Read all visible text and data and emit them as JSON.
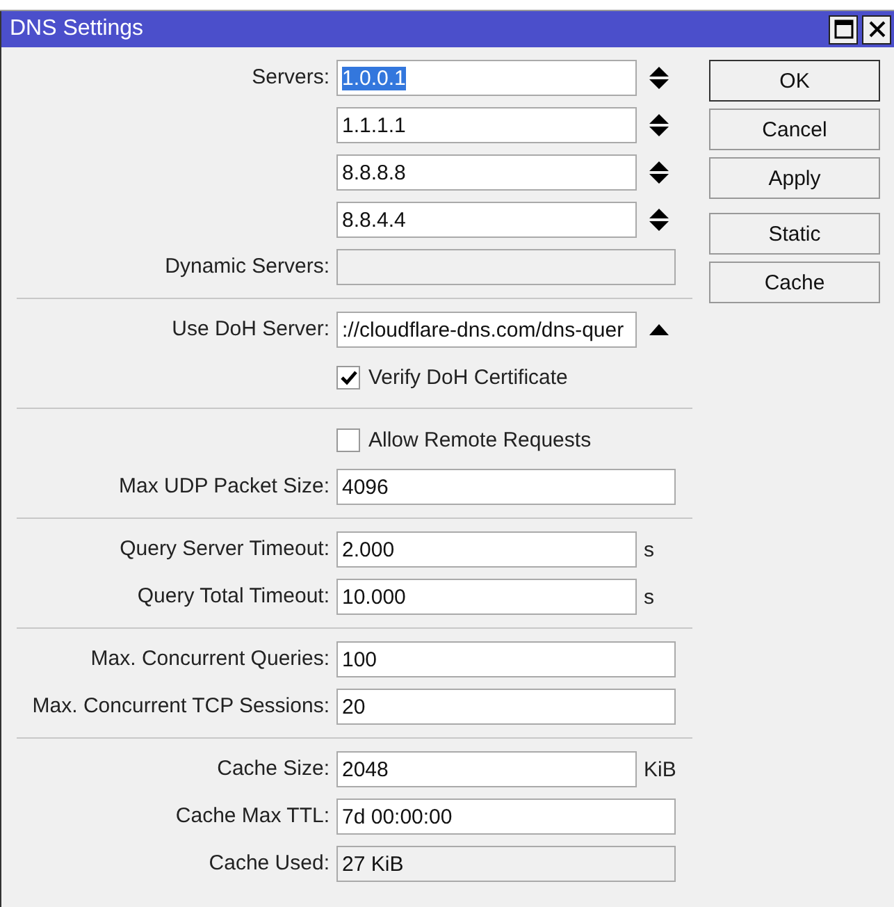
{
  "window": {
    "title": "DNS Settings"
  },
  "sections": [
    {
      "rows": [
        {
          "kind": "spin",
          "label": "Servers:",
          "value": "1.0.0.1",
          "highlighted": true,
          "disabled": false
        },
        {
          "kind": "spin",
          "value": "1.1.1.1",
          "highlighted": false,
          "disabled": false
        },
        {
          "kind": "spin",
          "value": "8.8.8.8",
          "highlighted": false,
          "disabled": false
        },
        {
          "kind": "spin",
          "value": "8.8.4.4",
          "highlighted": false,
          "disabled": false
        },
        {
          "kind": "field",
          "label": "Dynamic Servers:",
          "value": "",
          "highlighted": false,
          "disabled": true
        }
      ]
    },
    {
      "rows": [
        {
          "kind": "collapse",
          "label": "Use DoH Server:",
          "value": "://cloudflare-dns.com/dns-quer",
          "highlighted": false,
          "disabled": false
        },
        {
          "kind": "checkbox",
          "label": "Verify DoH Certificate",
          "checked": true
        }
      ]
    },
    {
      "rows": [
        {
          "kind": "checkbox",
          "label": "Allow Remote Requests",
          "checked": false
        },
        {
          "kind": "field",
          "label": "Max UDP Packet Size:",
          "value": "4096",
          "highlighted": false,
          "disabled": false
        }
      ]
    },
    {
      "rows": [
        {
          "kind": "field",
          "label": "Query Server Timeout:",
          "value": "2.000",
          "highlighted": false,
          "disabled": false,
          "unit": "s"
        },
        {
          "kind": "field",
          "label": "Query Total Timeout:",
          "value": "10.000",
          "highlighted": false,
          "disabled": false,
          "unit": "s"
        }
      ]
    },
    {
      "rows": [
        {
          "kind": "field",
          "label": "Max. Concurrent Queries:",
          "value": "100",
          "highlighted": false,
          "disabled": false
        },
        {
          "kind": "field",
          "label": "Max. Concurrent TCP Sessions:",
          "value": "20",
          "highlighted": false,
          "disabled": false
        }
      ]
    },
    {
      "rows": [
        {
          "kind": "field",
          "label": "Cache Size:",
          "value": "2048",
          "highlighted": false,
          "disabled": false,
          "unit": "KiB"
        },
        {
          "kind": "field",
          "label": "Cache Max TTL:",
          "value": "7d 00:00:00",
          "highlighted": false,
          "disabled": false
        },
        {
          "kind": "field",
          "label": "Cache Used:",
          "value": "27 KiB",
          "highlighted": false,
          "disabled": true
        }
      ]
    }
  ],
  "button_groups": [
    {
      "buttons": [
        {
          "label": "OK",
          "default": true
        },
        {
          "label": "Cancel",
          "default": false
        },
        {
          "label": "Apply",
          "default": false
        }
      ]
    },
    {
      "buttons": [
        {
          "label": "Static",
          "default": false
        },
        {
          "label": "Cache",
          "default": false
        }
      ]
    }
  ]
}
